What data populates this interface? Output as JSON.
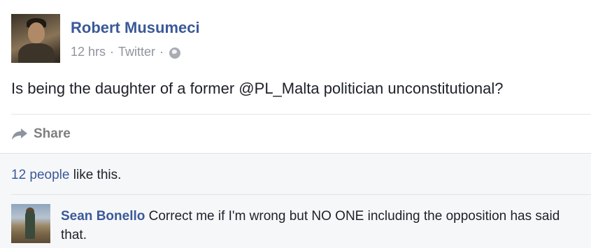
{
  "post": {
    "author": "Robert Musumeci",
    "time": "12 hrs",
    "separator": "·",
    "source": "Twitter",
    "text": "Is being the daughter of a former @PL_Malta politician unconstitutional?"
  },
  "actions": {
    "share_label": "Share"
  },
  "feedback": {
    "likes_link": "12 people",
    "likes_suffix": " like this."
  },
  "comment": {
    "author": "Sean Bonello",
    "text": " Correct me if I'm wrong but NO ONE including the opposition has said that."
  },
  "icons": {
    "privacy": "globe-icon",
    "share": "share-arrow-icon"
  },
  "colors": {
    "link": "#3b5998",
    "meta": "#90949c",
    "feedback_bg": "#f6f7f9"
  }
}
